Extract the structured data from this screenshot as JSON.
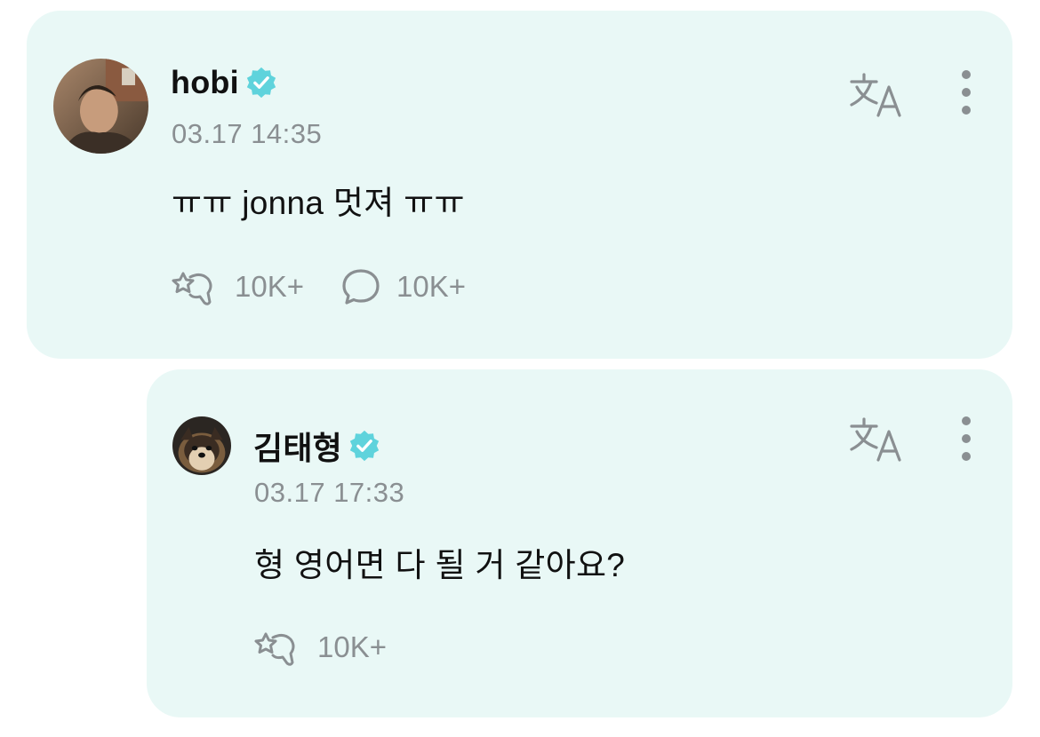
{
  "post": {
    "username": "hobi",
    "verified": true,
    "timestamp": "03.17 14:35",
    "text": "ㅠㅠ jonna 멋져 ㅠㅠ",
    "likes": "10K+",
    "comments": "10K+",
    "avatar_icon": "user-photo-avatar"
  },
  "reply": {
    "username": "김태형",
    "verified": true,
    "timestamp": "03.17 17:33",
    "text": "형 영어면 다 될 거 같아요?",
    "likes": "10K+",
    "avatar_icon": "dog-photo-avatar"
  },
  "colors": {
    "card_bg": "#e9f8f6",
    "verified": "#5fd3dc",
    "muted": "#8a8f92",
    "text": "#111111"
  },
  "icons": {
    "translate": "translate-icon",
    "more": "more-vertical-icon",
    "like": "star-hand-like-icon",
    "comment": "speech-bubble-icon",
    "verified": "verified-badge-icon"
  }
}
